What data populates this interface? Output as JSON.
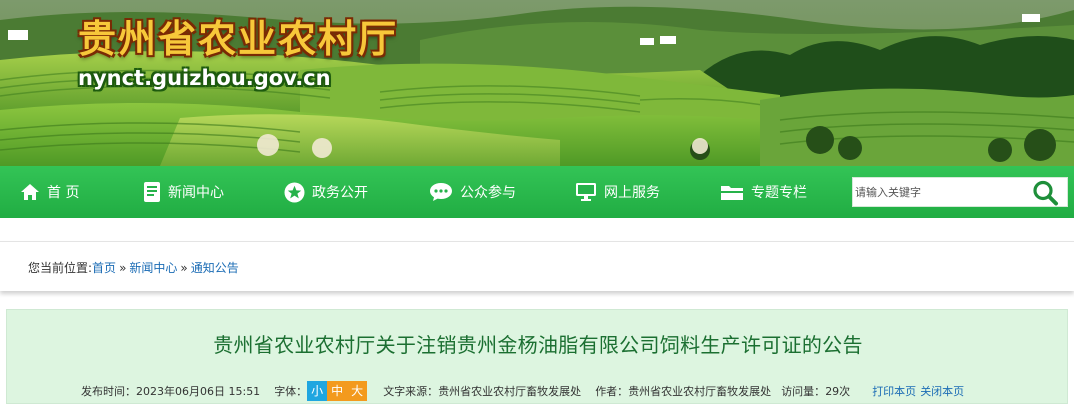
{
  "header": {
    "site_title": "贵州省农业农村厅",
    "site_domain": "nynct.guizhou.gov.cn"
  },
  "nav": {
    "items": [
      {
        "label": "首 页",
        "icon": "home-icon"
      },
      {
        "label": "新闻中心",
        "icon": "document-icon"
      },
      {
        "label": "政务公开",
        "icon": "star-icon"
      },
      {
        "label": "公众参与",
        "icon": "chat-icon"
      },
      {
        "label": "网上服务",
        "icon": "monitor-icon"
      },
      {
        "label": "专题专栏",
        "icon": "folder-icon"
      }
    ],
    "search_placeholder": "请输入关键字"
  },
  "breadcrumb": {
    "prefix": "您当前位置:",
    "items": [
      "首页",
      "新闻中心",
      "通知公告"
    ],
    "separator": "»"
  },
  "article": {
    "title": "贵州省农业农村厅关于注销贵州金杨油脂有限公司饲料生产许可证的公告",
    "publish_label": "发布时间：",
    "publish_time": "2023年06月06日 15:51",
    "font_label": "字体：",
    "font_sizes": [
      {
        "label": "小",
        "color": "#1fa6e0"
      },
      {
        "label": "中",
        "color": "#f39a1e"
      },
      {
        "label": "大",
        "color": "#f39a1e"
      }
    ],
    "source_label": "文字来源：",
    "source": "贵州省农业农村厅畜牧发展处",
    "author_label": "作者：",
    "author": "贵州省农业农村厅畜牧发展处",
    "views_label": "访问量：",
    "views": "29次",
    "print_label": "打印本页",
    "close_label": "关闭本页"
  },
  "colors": {
    "nav_green": "#26b24a",
    "title_green": "#1b6f31",
    "link_blue": "#1b6cb5",
    "article_bg": "#ddf5e0"
  }
}
